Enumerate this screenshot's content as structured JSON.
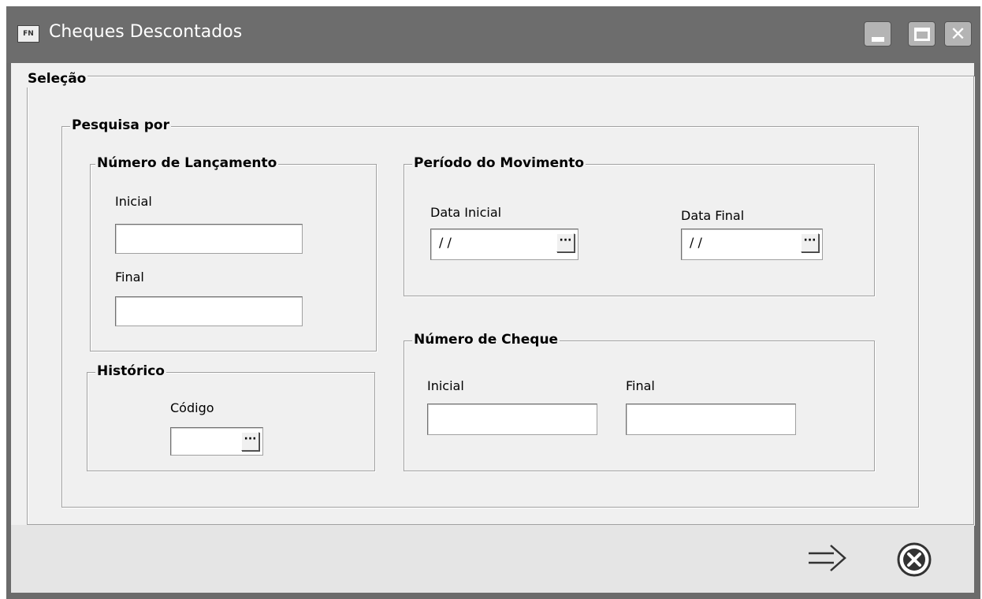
{
  "window": {
    "app_icon_text": "FN",
    "title": "Cheques Descontados",
    "controls": {
      "minimize": "minimize-icon",
      "maximize": "maximize-icon",
      "close": "close-icon"
    }
  },
  "selecao": {
    "legend": "Seleção",
    "pesquisa_por": {
      "legend": "Pesquisa por",
      "numero_lancamento": {
        "legend": "Número de Lançamento",
        "inicial_label": "Inicial",
        "inicial_value": "",
        "final_label": "Final",
        "final_value": ""
      },
      "historico": {
        "legend": "Histórico",
        "codigo_label": "Código",
        "codigo_value": "",
        "lookup_button": "···"
      },
      "periodo_movimento": {
        "legend": "Período do Movimento",
        "data_inicial_label": "Data Inicial",
        "data_inicial_value": "/ /",
        "data_final_label": "Data Final",
        "data_final_value": "/ /",
        "lookup_button": "···"
      },
      "numero_cheque": {
        "legend": "Número de Cheque",
        "inicial_label": "Inicial",
        "inicial_value": "",
        "final_label": "Final",
        "final_value": ""
      }
    }
  },
  "actions": {
    "confirm_icon": "arrow-right-icon",
    "cancel_icon": "cancel-circle-x-icon"
  }
}
